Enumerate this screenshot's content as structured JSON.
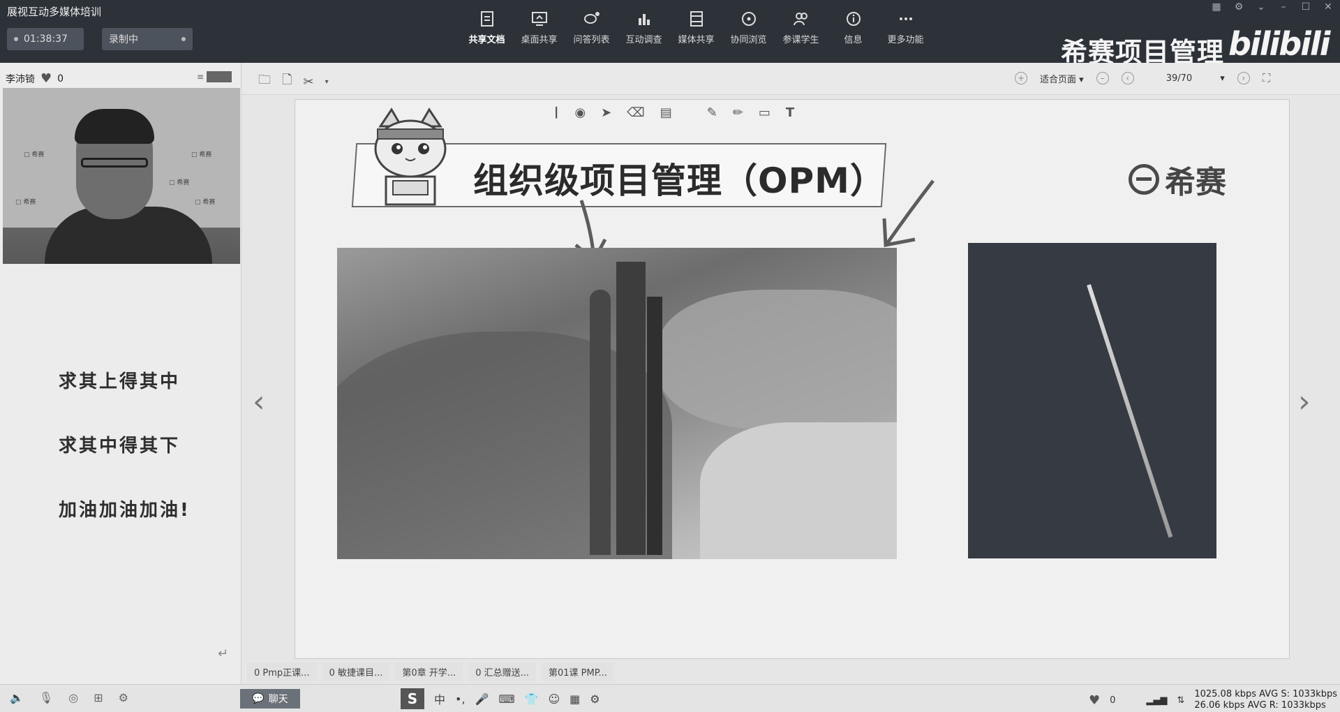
{
  "app": {
    "title": "展视互动多媒体培训",
    "timer": "01:38:37",
    "recording": "录制中",
    "brand": "希赛项目管理",
    "bilibili": "bilibili"
  },
  "toolbar": {
    "items": [
      {
        "label": "共享文档",
        "icon": "document-icon"
      },
      {
        "label": "桌面共享",
        "icon": "desktop-share-icon"
      },
      {
        "label": "问答列表",
        "icon": "qa-list-icon"
      },
      {
        "label": "互动调查",
        "icon": "bar-chart-icon"
      },
      {
        "label": "媒体共享",
        "icon": "film-icon"
      },
      {
        "label": "协同浏览",
        "icon": "compass-icon"
      },
      {
        "label": "参课学生",
        "icon": "users-icon"
      },
      {
        "label": "信息",
        "icon": "info-icon"
      },
      {
        "label": "更多功能",
        "icon": "more-icon"
      }
    ]
  },
  "left_panel": {
    "presenter_name": "李沛锜",
    "likes": "0",
    "motto": [
      "求其上得其中",
      "求其中得其下",
      "加油加油加油!"
    ]
  },
  "doc_toolbar": {
    "fit_label": "适合页面",
    "page": "39/70"
  },
  "slide": {
    "title": "组织级项目管理（OPM）",
    "logo_text": "希赛"
  },
  "doc_tabs": [
    "0 Pmp正课...",
    "0 敏捷课目...",
    "第0章 开学...",
    "0 汇总赠送...",
    "第01课 PMP..."
  ],
  "bottom": {
    "chat_label": "聊天",
    "ime_mode": "中",
    "likes": "0",
    "stat_up": "1025.08 kbps AVG S: 1033kbps",
    "stat_down": "26.06 kbps AVG R: 1033kbps"
  }
}
